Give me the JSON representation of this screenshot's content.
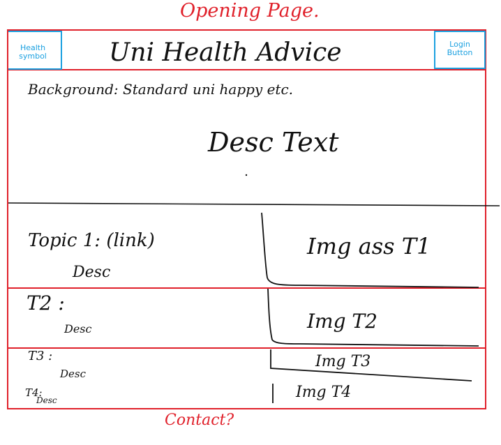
{
  "page_title": "Opening Page.",
  "header": {
    "health_symbol": [
      "Health",
      "symbol"
    ],
    "site_title": "Uni Health Advice",
    "login_button": [
      "Login",
      "Button"
    ]
  },
  "hero": {
    "background_note": "Background: Standard uni happy etc.",
    "desc_text": "Desc Text"
  },
  "topics": [
    {
      "label": "Topic 1: (link)",
      "desc": "Desc",
      "img": "Img ass T1"
    },
    {
      "label": "T2 :",
      "desc": "Desc",
      "img": "Img T2"
    },
    {
      "label": "T3 :",
      "desc": "Desc",
      "img": "Img T3"
    },
    {
      "label": "T4:",
      "desc": "Desc",
      "img": "Img T4"
    }
  ],
  "footer": {
    "contact": "Contact?"
  },
  "colors": {
    "wireframe_red": "#e0202a",
    "annotation_blue": "#1aa0e0",
    "ink": "#111111"
  }
}
